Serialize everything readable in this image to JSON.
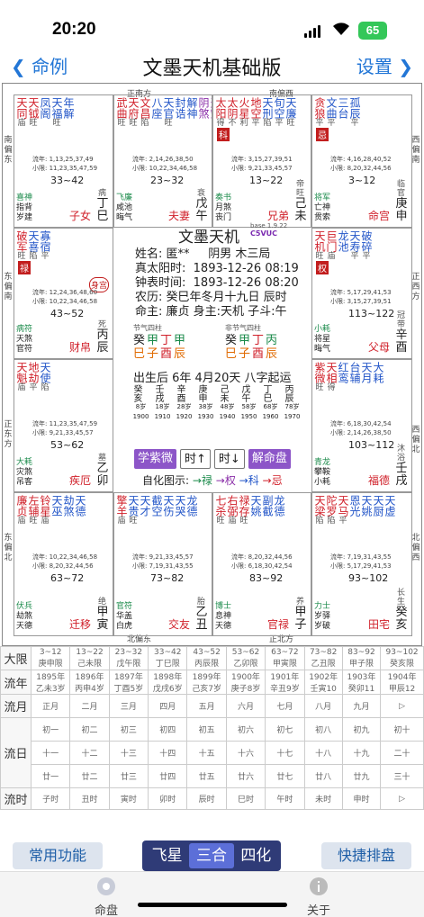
{
  "status": {
    "time": "20:20",
    "battery": "65"
  },
  "nav": {
    "back": "命例",
    "title": "文墨天机基础版",
    "settings": "设置"
  },
  "directions": {
    "top_main": "正南方",
    "top_sw": "南偏西",
    "top_left_corner": "南偏东",
    "bottom_main": "北偏东",
    "bottom_right": "正北方",
    "left_top": "南偏东",
    "left_mid": "东偏南",
    "left_low": "正东方",
    "left_bottom": "东偏北",
    "right_top": "西偏南",
    "right_mid": "正西方",
    "right_low": "西偏北",
    "right_bottom": "北偏西"
  },
  "palaces": [
    {
      "name": "子女",
      "gz": "丁巳",
      "state": "病",
      "range": "33~42",
      "lines": [
        "流年: 1,13,25,37,49",
        "小限: 11,23,35,47,59"
      ],
      "bl": [
        "喜神",
        "指背",
        "岁建"
      ],
      "stars": [
        {
          "n": "天同",
          "b": "庙",
          "c": "red"
        },
        {
          "n": "天钺",
          "b": "旺",
          "c": "red"
        },
        {
          "n": "凤阁",
          "b": "",
          "c": "blue"
        },
        {
          "n": "天福",
          "b": "旺",
          "c": "blue"
        },
        {
          "n": "年解",
          "b": "",
          "c": "blue"
        }
      ]
    },
    {
      "name": "夫妻",
      "gz": "戊午",
      "state": "衰",
      "range": "23~32",
      "lines": [
        "流年: 2,14,26,38,50",
        "小限: 10,22,34,46,58"
      ],
      "bl": [
        "飞廉",
        "咸池",
        "晦气"
      ],
      "stars": [
        {
          "n": "武曲",
          "b": "旺",
          "c": "red"
        },
        {
          "n": "天府",
          "b": "旺",
          "c": "red"
        },
        {
          "n": "文昌",
          "b": "陷",
          "c": "red"
        },
        {
          "n": "八座",
          "b": "",
          "c": "blue"
        },
        {
          "n": "天官",
          "b": "旺",
          "c": "blue"
        },
        {
          "n": "封诰",
          "b": "",
          "c": "blue"
        },
        {
          "n": "解神",
          "b": "",
          "c": "blue"
        },
        {
          "n": "阴煞",
          "b": "",
          "c": "pur"
        },
        {
          "n": "天空",
          "b": "",
          "c": "pur"
        },
        {
          "n": "咸池",
          "b": "",
          "c": "pur"
        },
        {
          "n": "破碎",
          "b": "",
          "c": "pur"
        },
        {
          "n": "旬空",
          "b": "",
          "c": "pur"
        }
      ]
    },
    {
      "name": "兄弟",
      "gz": "己未",
      "state": "帝旺",
      "range": "13~22",
      "lines": [
        "流年: 3,15,27,39,51",
        "小限: 9,21,33,45,57"
      ],
      "bl": [
        "奏书",
        "月煞",
        "丧门"
      ],
      "stars": [
        {
          "n": "太阳",
          "b": "得",
          "c": "red"
        },
        {
          "n": "太阴",
          "b": "不",
          "c": "red"
        },
        {
          "n": "火星",
          "b": "利",
          "c": "red"
        },
        {
          "n": "地空",
          "b": "平",
          "c": "red"
        },
        {
          "n": "天刑",
          "b": "陷",
          "c": "blue"
        },
        {
          "n": "旬空",
          "b": "平",
          "c": "blue"
        },
        {
          "n": "天廉",
          "b": "旺",
          "c": "blue"
        }
      ],
      "hua": "科"
    },
    {
      "name": "命宫",
      "gz": "庚申",
      "state": "临官",
      "range": "3~12",
      "lines": [
        "流年: 4,16,28,40,52",
        "小限: 8,20,32,44,56"
      ],
      "bl": [
        "将军",
        "亡神",
        "贯索"
      ],
      "stars": [
        {
          "n": "贪狼",
          "b": "平",
          "c": "red"
        },
        {
          "n": "文曲",
          "b": "平",
          "c": "blue"
        },
        {
          "n": "三台",
          "b": "",
          "c": "blue"
        },
        {
          "n": "孤辰",
          "b": "平",
          "c": "blue"
        }
      ],
      "hua": "忌"
    },
    {
      "name": "财帛",
      "gz": "丙辰",
      "state": "死",
      "range": "43~52",
      "lines": [
        "流年: 12,24,36,48,60",
        "小限: 10,22,34,46,58"
      ],
      "bl": [
        "病符",
        "天煞",
        "官符"
      ],
      "stars": [
        {
          "n": "破军",
          "b": "旺",
          "c": "red"
        },
        {
          "n": "天喜",
          "b": "陷",
          "c": "blue"
        },
        {
          "n": "寡宿",
          "b": "平",
          "c": "blue"
        }
      ],
      "hua": "禄",
      "tag": "身宫"
    },
    {
      "name": "父母",
      "gz": "辛酉",
      "state": "冠带",
      "range": "113~122",
      "lines": [
        "流年: 5,17,29,41,53",
        "小限: 3,15,27,39,51"
      ],
      "bl": [
        "小耗",
        "将星",
        "晦气"
      ],
      "stars": [
        {
          "n": "天机",
          "b": "旺",
          "c": "red"
        },
        {
          "n": "巨门",
          "b": "庙",
          "c": "red"
        },
        {
          "n": "龙池",
          "b": "",
          "c": "blue"
        },
        {
          "n": "天寿",
          "b": "平",
          "c": "blue"
        },
        {
          "n": "破碎",
          "b": "平",
          "c": "blue"
        }
      ],
      "hua": "权"
    },
    {
      "name": "疾厄",
      "gz": "乙卯",
      "state": "墓",
      "range": "53~62",
      "lines": [
        "流年: 11,23,35,47,59",
        "小限: 9,21,33,45,57"
      ],
      "bl": [
        "大耗",
        "灾煞",
        "吊客"
      ],
      "stars": [
        {
          "n": "天魁",
          "b": "庙",
          "c": "red"
        },
        {
          "n": "地劫",
          "b": "平",
          "c": "red"
        },
        {
          "n": "天使",
          "b": "陷",
          "c": "blue"
        }
      ]
    },
    {
      "name": "福德",
      "gz": "壬戌",
      "state": "沐浴",
      "range": "103~112",
      "lines": [
        "流年: 6,18,30,42,54",
        "小限: 2,14,26,38,50"
      ],
      "bl": [
        "青龙",
        "攀鞍",
        "小耗"
      ],
      "stars": [
        {
          "n": "紫微",
          "b": "旺",
          "c": "red"
        },
        {
          "n": "天相",
          "b": "得",
          "c": "red"
        },
        {
          "n": "红鸾",
          "b": "",
          "c": "blue"
        },
        {
          "n": "台辅",
          "b": "",
          "c": "blue"
        },
        {
          "n": "天月",
          "b": "",
          "c": "blue"
        },
        {
          "n": "大耗",
          "b": "",
          "c": "blue"
        }
      ]
    },
    {
      "name": "迁移",
      "gz": "甲寅",
      "state": "绝",
      "range": "63~72",
      "lines": [
        "流年: 10,22,34,46,58",
        "小限: 8,20,32,44,56"
      ],
      "bl": [
        "伏兵",
        "劫煞",
        "天德"
      ],
      "stars": [
        {
          "n": "廉贞",
          "b": "庙",
          "c": "red"
        },
        {
          "n": "左辅",
          "b": "旺",
          "c": "red"
        },
        {
          "n": "铃星",
          "b": "庙",
          "c": "red"
        },
        {
          "n": "天巫",
          "b": "",
          "c": "blue"
        },
        {
          "n": "劫煞",
          "b": "",
          "c": "blue"
        },
        {
          "n": "天德",
          "b": "",
          "c": "blue"
        }
      ]
    },
    {
      "name": "交友",
      "gz": "乙丑",
      "state": "胎",
      "range": "73~82",
      "lines": [
        "流年: 9,21,33,45,57",
        "小限: 7,19,31,43,55"
      ],
      "bl": [
        "官符",
        "华盖",
        "白虎"
      ],
      "stars": [
        {
          "n": "擎羊",
          "b": "庙",
          "c": "red"
        },
        {
          "n": "天贵",
          "b": "旺",
          "c": "blue"
        },
        {
          "n": "天才",
          "b": "",
          "c": "blue"
        },
        {
          "n": "截空",
          "b": "",
          "c": "blue"
        },
        {
          "n": "天伤",
          "b": "",
          "c": "blue"
        },
        {
          "n": "天哭",
          "b": "",
          "c": "blue"
        },
        {
          "n": "龙德",
          "b": "",
          "c": "blue"
        }
      ]
    },
    {
      "name": "官禄",
      "gz": "甲子",
      "state": "养",
      "range": "83~92",
      "lines": [
        "流年: 8,20,32,44,56",
        "小限: 6,18,30,42,54"
      ],
      "bl": [
        "博士",
        "息神",
        "天德"
      ],
      "stars": [
        {
          "n": "七杀",
          "b": "旺",
          "c": "red"
        },
        {
          "n": "右弼",
          "b": "庙",
          "c": "red"
        },
        {
          "n": "禄存",
          "b": "旺",
          "c": "red"
        },
        {
          "n": "天姚",
          "b": "",
          "c": "blue"
        },
        {
          "n": "副截",
          "b": "",
          "c": "blue"
        },
        {
          "n": "龙德",
          "b": "",
          "c": "blue"
        }
      ]
    },
    {
      "name": "田宅",
      "gz": "癸亥",
      "state": "长生",
      "range": "93~102",
      "lines": [
        "流年: 7,19,31,43,55",
        "小限: 5,17,29,41,53"
      ],
      "bl": [
        "力士",
        "岁驿",
        "岁破"
      ],
      "stars": [
        {
          "n": "天梁",
          "b": "陷",
          "c": "red"
        },
        {
          "n": "陀罗",
          "b": "陷",
          "c": "red"
        },
        {
          "n": "天马",
          "b": "平",
          "c": "red"
        },
        {
          "n": "恩光",
          "b": "",
          "c": "blue"
        },
        {
          "n": "天姚",
          "b": "",
          "c": "blue"
        },
        {
          "n": "天厨",
          "b": "",
          "c": "blue"
        },
        {
          "n": "天虚",
          "b": "",
          "c": "blue"
        }
      ]
    }
  ],
  "center": {
    "title": "文墨天机",
    "version": "base 1.9.22",
    "code": "C5VUC",
    "name": "姓名: 匿**",
    "yin": "阴男 木三局",
    "solar": "真太阳时:",
    "solar_v": "1893-12-26 08:19",
    "clock": "钟表时间:",
    "clock_v": "1893-12-26 08:20",
    "lunar": "农历: 癸巳年冬月十九日 辰时",
    "ming": "命主: 廉贞 身主:天机 子斗:午",
    "jieqi1": "节气四柱",
    "jieqi2": "非节气四柱",
    "gz1": [
      "癸",
      "甲",
      "丁",
      "甲"
    ],
    "gz1b": [
      "巳",
      "子",
      "酉",
      "辰"
    ],
    "gz2": [
      "癸",
      "甲",
      "丁",
      "丙"
    ],
    "gz2b": [
      "巳",
      "子",
      "酉",
      "辰"
    ],
    "qiyun": "出生后 6年 4月20天 八字起运",
    "dayun": [
      "癸亥",
      "壬戌",
      "辛酉",
      "庚申",
      "己未",
      "戊午",
      "丁巳",
      "丙辰"
    ],
    "dayun_age": [
      "8岁",
      "18岁",
      "28岁",
      "38岁",
      "48岁",
      "58岁",
      "68岁",
      "78岁"
    ],
    "dayun_year": [
      "1900",
      "1910",
      "1920",
      "1930",
      "1940",
      "1950",
      "1960",
      "1970"
    ],
    "btn_ziwei": "学紫微",
    "btn_prev": "时↑",
    "btn_next": "时↓",
    "btn_jie": "解命盘",
    "legend_prefix": "自化图示:",
    "legend": [
      "→禄",
      "→权",
      "→科",
      "→忌"
    ]
  },
  "table": {
    "daxian_h": "大限",
    "daxian": [
      "3~12\n庚申限",
      "13~22\n己未限",
      "23~32\n戊午限",
      "33~42\n丁巳限",
      "43~52\n丙辰限",
      "53~62\n乙卯限",
      "63~72\n甲寅限",
      "73~82\n乙丑限",
      "83~92\n甲子限",
      "93~102\n癸亥限"
    ],
    "liunian_h": "流年",
    "liunian": [
      "1895年\n乙未3岁",
      "1896年\n丙申4岁",
      "1897年\n丁酉5岁",
      "1898年\n戊戌6岁",
      "1899年\n己亥7岁",
      "1900年\n庚子8岁",
      "1901年\n辛丑9岁",
      "1902年\n壬寅10",
      "1903年\n癸卯11",
      "1904年\n甲辰12"
    ],
    "liuyue_h": "流月",
    "liuyue": [
      "正月",
      "二月",
      "三月",
      "四月",
      "五月",
      "六月",
      "七月",
      "八月",
      "九月",
      "▷"
    ],
    "liuri_h": "流日",
    "liuri": [
      [
        "初一",
        "初二",
        "初三",
        "初四",
        "初五",
        "初六",
        "初七",
        "初八",
        "初九",
        "初十"
      ],
      [
        "十一",
        "十二",
        "十三",
        "十四",
        "十五",
        "十六",
        "十七",
        "十八",
        "十九",
        "二十"
      ],
      [
        "廿一",
        "廿二",
        "廿三",
        "廿四",
        "廿五",
        "廿六",
        "廿七",
        "廿八",
        "廿九",
        "三十"
      ]
    ],
    "liushi_h": "流时",
    "liushi": [
      "子时",
      "丑时",
      "寅时",
      "卯时",
      "辰时",
      "巳时",
      "午时",
      "未时",
      "申时",
      "▷"
    ]
  },
  "bottom": {
    "common": "常用功能",
    "seg": [
      "飞星",
      "三合",
      "四化"
    ],
    "quick": "快捷排盘"
  },
  "tabs": {
    "left": "命盘",
    "right": "关于"
  }
}
